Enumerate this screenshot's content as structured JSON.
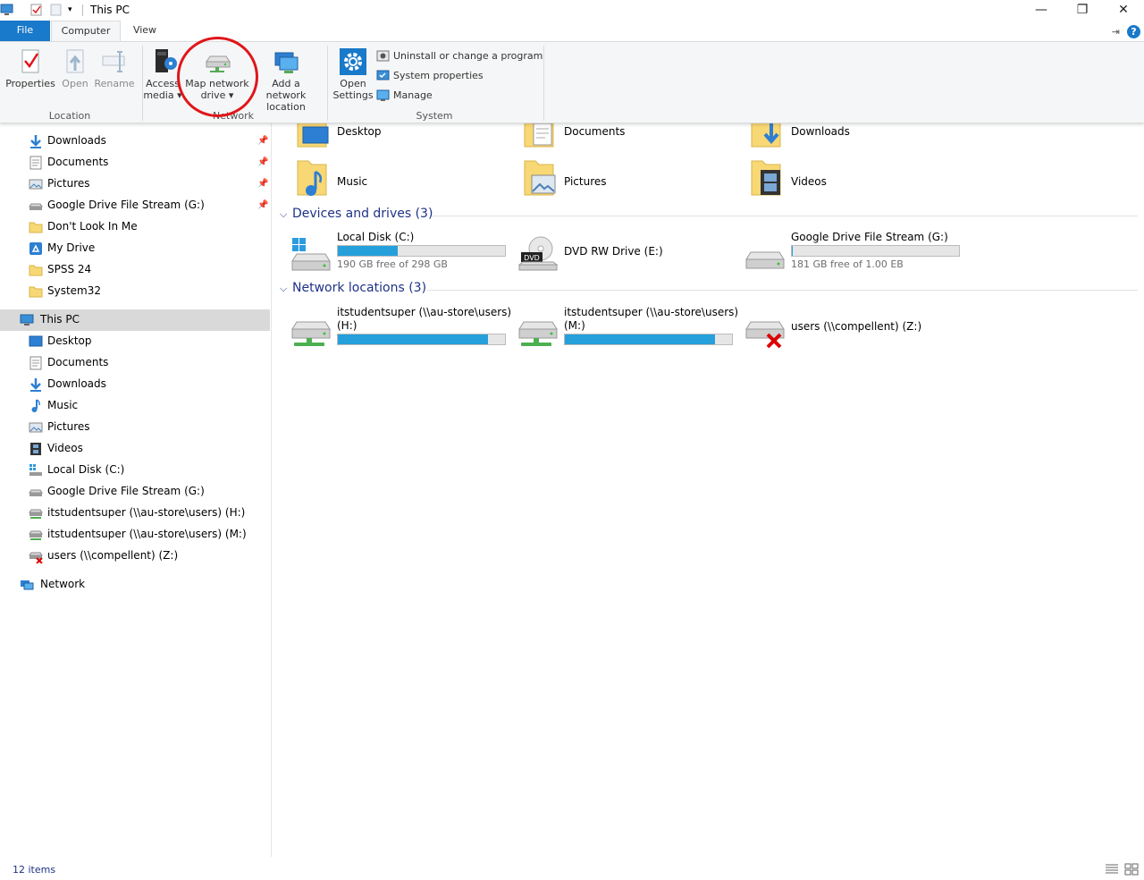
{
  "window": {
    "title": "This PC",
    "minimize": "—",
    "restore": "❐",
    "close": "✕"
  },
  "ribbon": {
    "tabs": {
      "file": "File",
      "computer": "Computer",
      "view": "View"
    },
    "location": {
      "label": "Location",
      "properties": "Properties",
      "open": "Open",
      "rename": "Rename"
    },
    "network": {
      "label": "Network",
      "access_media_l1": "Access",
      "access_media_l2": "media",
      "map_drive_l1": "Map network",
      "map_drive_l2": "drive",
      "add_location_l1": "Add a network",
      "add_location_l2": "location"
    },
    "system": {
      "label": "System",
      "open_settings_l1": "Open",
      "open_settings_l2": "Settings",
      "uninstall": "Uninstall or change a program",
      "system_properties": "System properties",
      "manage": "Manage"
    }
  },
  "nav": {
    "quick_access": [
      {
        "label": "Downloads",
        "icon": "download-arrow-icon",
        "pinned": true
      },
      {
        "label": "Documents",
        "icon": "document-icon",
        "pinned": true
      },
      {
        "label": "Pictures",
        "icon": "pictures-icon",
        "pinned": true
      },
      {
        "label": "Google Drive File Stream (G:)",
        "icon": "drive-icon",
        "pinned": true
      },
      {
        "label": "Don't Look In Me",
        "icon": "folder-icon",
        "pinned": false
      },
      {
        "label": "My Drive",
        "icon": "google-drive-icon",
        "pinned": false
      },
      {
        "label": "SPSS 24",
        "icon": "folder-icon",
        "pinned": false
      },
      {
        "label": "System32",
        "icon": "folder-icon",
        "pinned": false
      }
    ],
    "this_pc": "This PC",
    "this_pc_items": [
      {
        "label": "Desktop",
        "icon": "desktop-icon"
      },
      {
        "label": "Documents",
        "icon": "document-icon"
      },
      {
        "label": "Downloads",
        "icon": "download-arrow-icon"
      },
      {
        "label": "Music",
        "icon": "music-note-icon"
      },
      {
        "label": "Pictures",
        "icon": "pictures-icon"
      },
      {
        "label": "Videos",
        "icon": "film-icon"
      },
      {
        "label": "Local Disk (C:)",
        "icon": "windows-drive-icon"
      },
      {
        "label": "Google Drive File Stream (G:)",
        "icon": "drive-icon"
      },
      {
        "label": "itstudentsuper (\\\\au-store\\users) (H:)",
        "icon": "network-drive-icon"
      },
      {
        "label": "itstudentsuper (\\\\au-store\\users) (M:)",
        "icon": "network-drive-icon"
      },
      {
        "label": "users (\\\\compellent) (Z:)",
        "icon": "disconnected-drive-icon"
      }
    ],
    "network": "Network"
  },
  "content": {
    "folders": [
      {
        "label": "Desktop",
        "icon": "desktop-folder-icon"
      },
      {
        "label": "Documents",
        "icon": "documents-folder-icon"
      },
      {
        "label": "Downloads",
        "icon": "downloads-folder-icon"
      },
      {
        "label": "Music",
        "icon": "music-folder-icon"
      },
      {
        "label": "Pictures",
        "icon": "pictures-folder-icon"
      },
      {
        "label": "Videos",
        "icon": "videos-folder-icon"
      }
    ],
    "devices_header": "Devices and drives (3)",
    "drives": [
      {
        "name": "Local Disk (C:)",
        "free": "190 GB free of 298 GB",
        "used_fraction": 0.36,
        "icon": "windows-drive-icon"
      },
      {
        "name": "DVD RW Drive (E:)",
        "icon": "dvd-drive-icon",
        "dvd_label": "DVD"
      },
      {
        "name": "Google Drive File Stream (G:)",
        "free": "181 GB free of 1.00 EB",
        "used_fraction": 0.005,
        "icon": "drive-icon"
      }
    ],
    "network_header": "Network locations (3)",
    "network_drives": [
      {
        "name_l1": "itstudentsuper (\\\\au-store\\users)",
        "name_l2": "(H:)",
        "used_fraction": 0.9,
        "icon": "network-drive-icon"
      },
      {
        "name_l1": "itstudentsuper (\\\\au-store\\users)",
        "name_l2": "(M:)",
        "used_fraction": 0.9,
        "icon": "network-drive-icon"
      },
      {
        "name": "users (\\\\compellent) (Z:)",
        "icon": "disconnected-drive-icon"
      }
    ]
  },
  "status": {
    "items": "12 items"
  },
  "colors": {
    "accent": "#1979ca",
    "bar_fill": "#26a0da",
    "annotation": "#e0161b",
    "section_header": "#1e3287"
  }
}
